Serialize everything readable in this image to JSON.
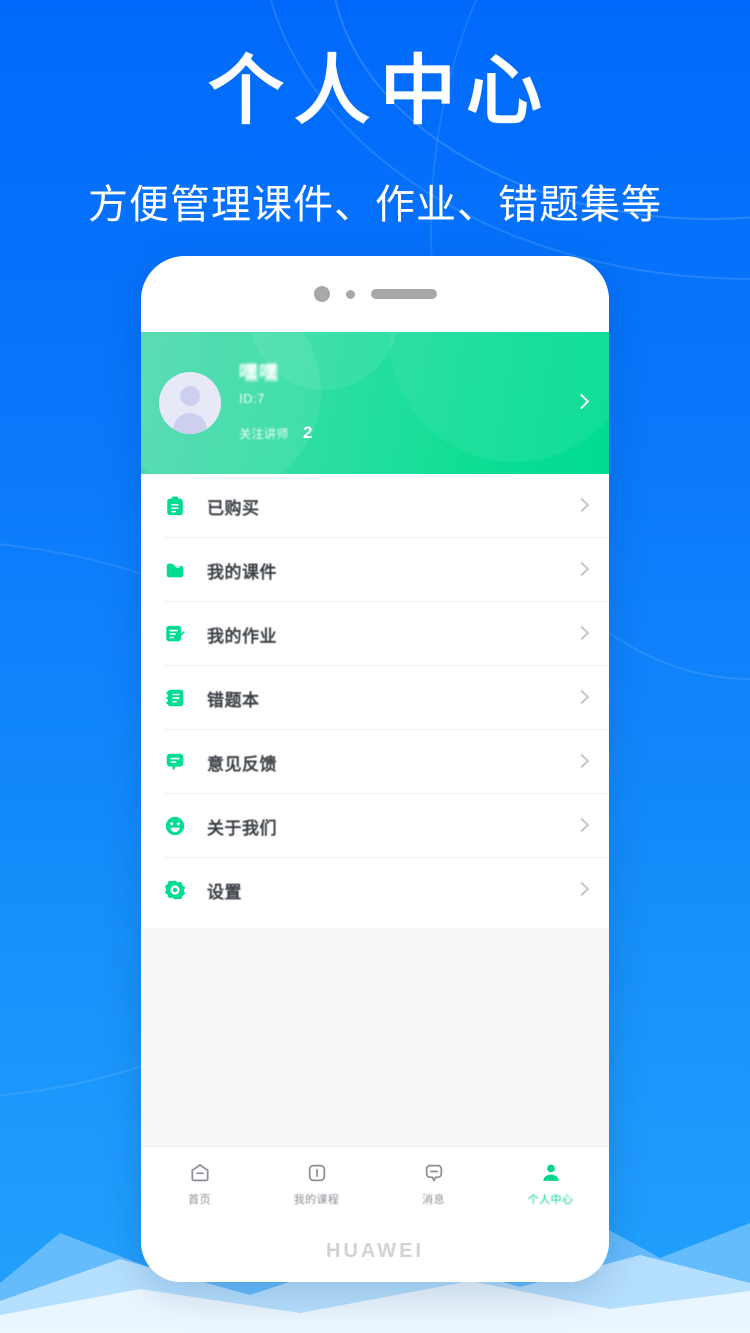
{
  "promo": {
    "title": "个人中心",
    "subtitle": "方便管理课件、作业、错题集等",
    "background_top_color": "#0069fb",
    "background_bottom_color": "#24a2fc"
  },
  "phone": {
    "brand_label": "HUAWEI",
    "notch": {
      "sensor_large": "camera-dot",
      "sensor_small": "sensor-dot",
      "speaker": "earpiece-speaker"
    }
  },
  "profile": {
    "name": "嘿嘿",
    "id": "ID:7",
    "follow_label": "关注讲师",
    "follow_count": "2",
    "arrow": "chevron-right-icon",
    "avatar": "default-user-avatar",
    "gradient_start": "#4ed8ae",
    "gradient_end": "#00db93"
  },
  "menu": {
    "items": [
      {
        "label": "已购买",
        "icon": "clipboard-icon"
      },
      {
        "label": "我的课件",
        "icon": "folder-icon"
      },
      {
        "label": "我的作业",
        "icon": "document-edit-icon"
      },
      {
        "label": "错题本",
        "icon": "notebook-icon"
      },
      {
        "label": "意见反馈",
        "icon": "chat-bubble-icon"
      },
      {
        "label": "关于我们",
        "icon": "smiley-face-icon"
      },
      {
        "label": "设置",
        "icon": "settings-gear-icon"
      }
    ],
    "icon_color": "#00dd93",
    "arrow_icon": "chevron-right-icon"
  },
  "tabbar": {
    "items": [
      {
        "label": "首页",
        "icon": "home-icon",
        "active": false
      },
      {
        "label": "我的课程",
        "icon": "courses-icon",
        "active": false
      },
      {
        "label": "消息",
        "icon": "message-icon",
        "active": false
      },
      {
        "label": "个人中心",
        "icon": "profile-icon",
        "active": true
      }
    ],
    "active_color": "#00d68f",
    "inactive_color": "#8b9096"
  }
}
